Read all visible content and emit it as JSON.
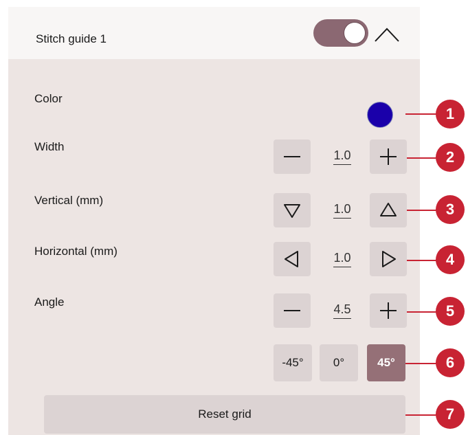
{
  "header": {
    "title": "Stitch guide 1",
    "toggle_on": true
  },
  "rows": {
    "color": {
      "label": "Color",
      "swatch": "#1a00aa"
    },
    "width": {
      "label": "Width",
      "value": "1.0"
    },
    "vertical": {
      "label": "Vertical (mm)",
      "value": "1.0"
    },
    "horizontal": {
      "label": "Horizontal (mm)",
      "value": "1.0"
    },
    "angle": {
      "label": "Angle",
      "value": "4.5"
    }
  },
  "angle_presets": [
    {
      "label": "-45°",
      "active": false
    },
    {
      "label": "0°",
      "active": false
    },
    {
      "label": "45°",
      "active": true
    }
  ],
  "reset_label": "Reset grid",
  "callouts": [
    "1",
    "2",
    "3",
    "4",
    "5",
    "6",
    "7"
  ],
  "colors": {
    "accent": "#8b6872",
    "active": "#957077",
    "callout": "#c82333",
    "panel": "#ede5e3",
    "button": "#dcd3d3"
  },
  "icons": [
    "chevron-up-icon",
    "minus-icon",
    "plus-icon",
    "triangle-down-icon",
    "triangle-up-icon",
    "triangle-left-icon",
    "triangle-right-icon"
  ]
}
